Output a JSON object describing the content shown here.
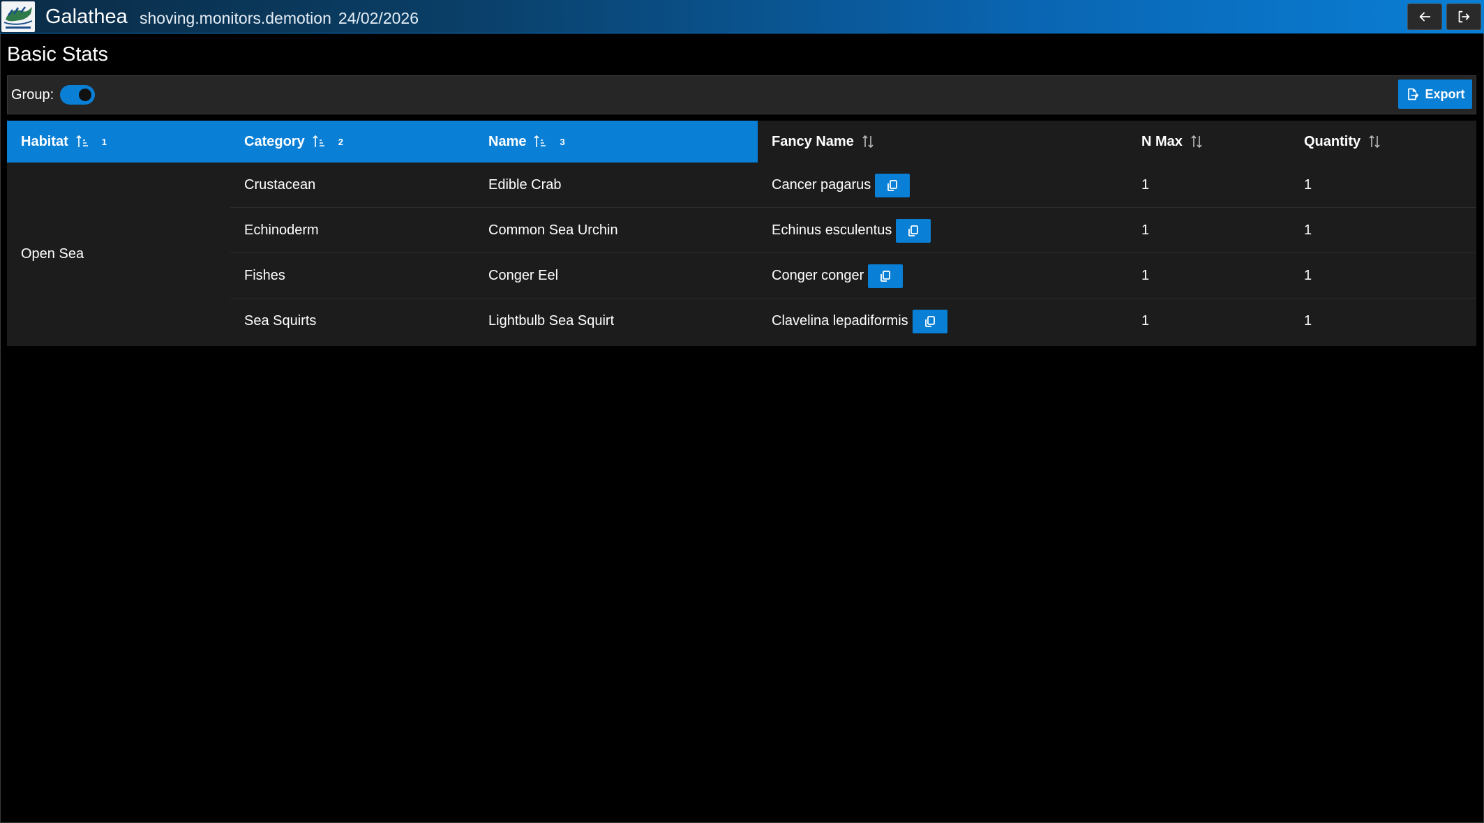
{
  "app": {
    "title": "Galathea",
    "session_name": "shoving.monitors.demotion",
    "session_date": "24/02/2026",
    "logo_icon": "galathea-logo-icon",
    "back_icon": "arrow-left-icon",
    "exit_icon": "logout-icon"
  },
  "page": {
    "title": "Basic Stats"
  },
  "toolbar": {
    "group_label": "Group:",
    "group_enabled": true,
    "export_label": "Export",
    "export_icon": "file-export-icon"
  },
  "table": {
    "columns": [
      {
        "key": "habitat",
        "label": "Habitat",
        "sort_order": "1",
        "grouped": true
      },
      {
        "key": "category",
        "label": "Category",
        "sort_order": "2",
        "grouped": true
      },
      {
        "key": "name",
        "label": "Name",
        "sort_order": "3",
        "grouped": true
      },
      {
        "key": "fancy_name",
        "label": "Fancy Name",
        "sort_order": "",
        "grouped": false
      },
      {
        "key": "n_max",
        "label": "N Max",
        "sort_order": "",
        "grouped": false
      },
      {
        "key": "quantity",
        "label": "Quantity",
        "sort_order": "",
        "grouped": false
      }
    ],
    "group_value": "Open Sea",
    "rows": [
      {
        "category": "Crustacean",
        "name": "Edible Crab",
        "fancy_name": "Cancer pagarus",
        "n_max": "1",
        "quantity": "1"
      },
      {
        "category": "Echinoderm",
        "name": "Common Sea Urchin",
        "fancy_name": "Echinus esculentus",
        "n_max": "1",
        "quantity": "1"
      },
      {
        "category": "Fishes",
        "name": "Conger Eel",
        "fancy_name": "Conger conger",
        "n_max": "1",
        "quantity": "1"
      },
      {
        "category": "Sea Squirts",
        "name": "Lightbulb Sea Squirt",
        "fancy_name": "Clavelina lepadiformis",
        "n_max": "1",
        "quantity": "1"
      }
    ]
  },
  "colors": {
    "accent": "#0a7fd6",
    "background": "#000000",
    "table_bg": "#1c1c1c",
    "toolbar_bg": "#262626"
  }
}
